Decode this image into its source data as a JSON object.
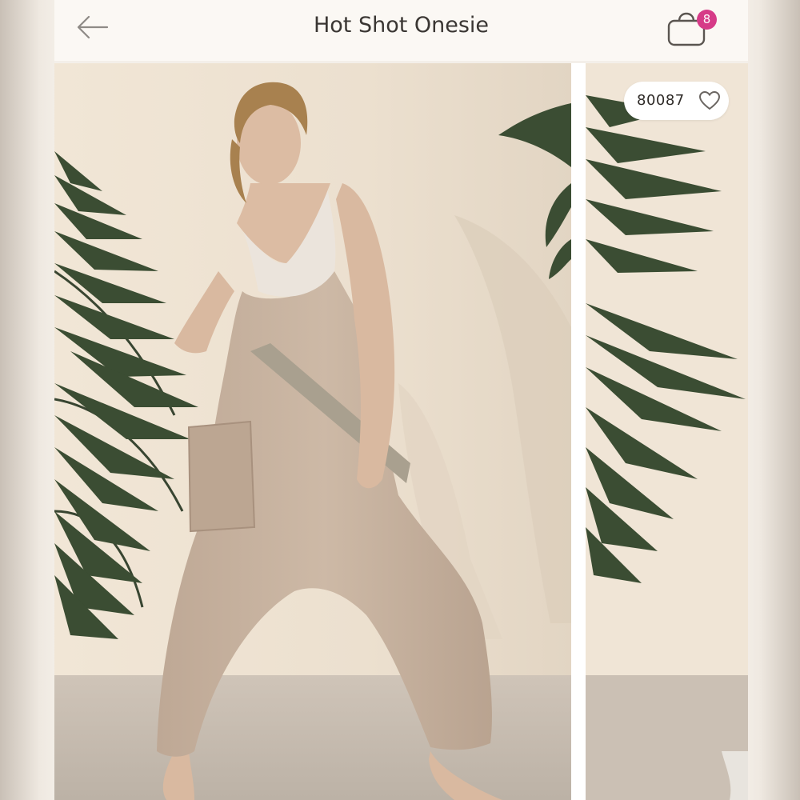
{
  "header": {
    "title": "Hot Shot Onesie",
    "back_icon": "arrow-left-icon",
    "bag_icon": "shopping-bag-icon",
    "bag_badge_count": "8"
  },
  "gallery": {
    "main_image": "photo-model-in-taupe-onesie",
    "next_image": "photo-palm-leaves-partial",
    "likes": {
      "count": "80087",
      "icon": "heart-outline-icon"
    }
  },
  "colors": {
    "badge": "#d63b88",
    "background": "#fbf8f4",
    "garment": "#c9b5a3"
  }
}
